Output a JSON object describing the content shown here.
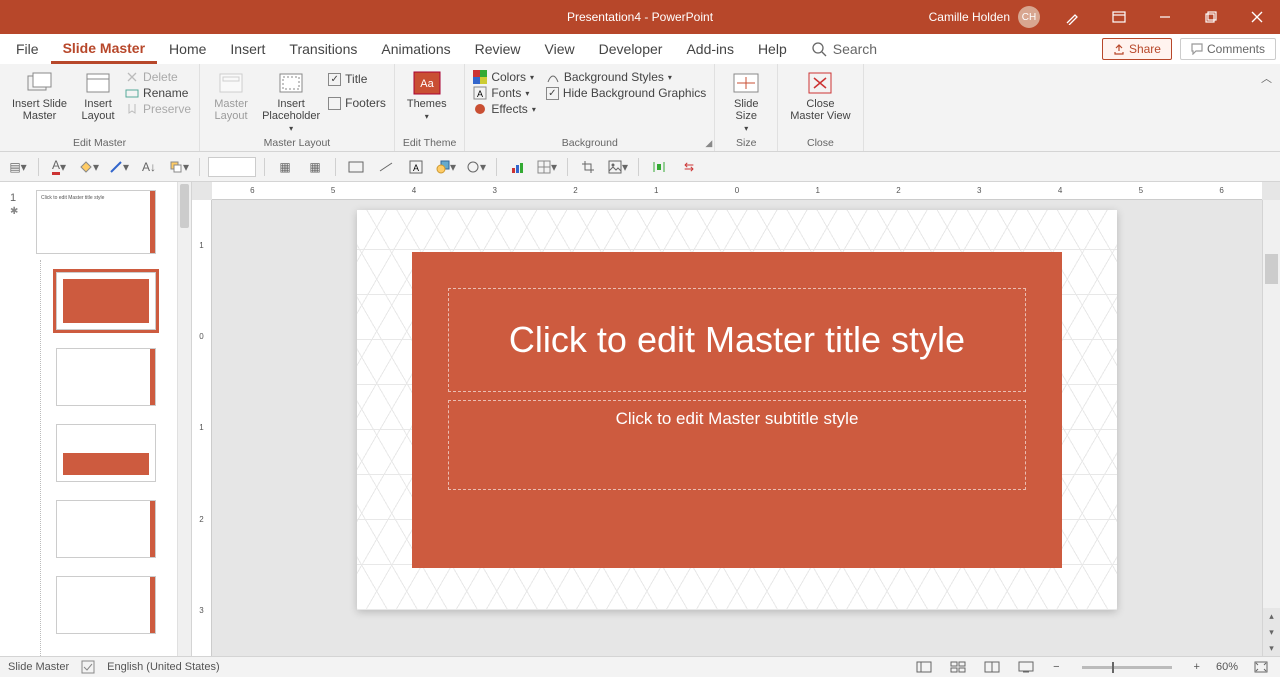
{
  "titlebar": {
    "title": "Presentation4  -  PowerPoint",
    "user": "Camille Holden",
    "avatar": "CH"
  },
  "tabs": {
    "file": "File",
    "slide_master": "Slide Master",
    "home": "Home",
    "insert": "Insert",
    "transitions": "Transitions",
    "animations": "Animations",
    "review": "Review",
    "view": "View",
    "developer": "Developer",
    "addins": "Add-ins",
    "help": "Help",
    "search": "Search",
    "share": "Share",
    "comments": "Comments"
  },
  "ribbon": {
    "edit_master": {
      "insert_slide_master": "Insert Slide\nMaster",
      "insert_layout": "Insert\nLayout",
      "delete": "Delete",
      "rename": "Rename",
      "preserve": "Preserve",
      "label": "Edit Master"
    },
    "master_layout": {
      "master_layout_btn": "Master\nLayout",
      "insert_placeholder": "Insert\nPlaceholder",
      "title": "Title",
      "footers": "Footers",
      "label": "Master Layout"
    },
    "edit_theme": {
      "themes": "Themes",
      "label": "Edit Theme"
    },
    "background": {
      "colors": "Colors",
      "fonts": "Fonts",
      "effects": "Effects",
      "bg_styles": "Background Styles",
      "hide_bg": "Hide Background Graphics",
      "label": "Background"
    },
    "size": {
      "slide_size": "Slide\nSize",
      "label": "Size"
    },
    "close": {
      "close_master": "Close\nMaster View",
      "label": "Close"
    }
  },
  "ruler": {
    "h": [
      "6",
      "5",
      "4",
      "3",
      "2",
      "1",
      "0",
      "1",
      "2",
      "3",
      "4",
      "5",
      "6"
    ],
    "v": [
      "1",
      "0",
      "1",
      "2",
      "3"
    ]
  },
  "slide": {
    "title_ph": "Click to edit Master title style",
    "subtitle_ph": "Click to edit Master subtitle style"
  },
  "panel": {
    "num": "1"
  },
  "status": {
    "view": "Slide Master",
    "lang": "English (United States)",
    "zoom": "60%"
  }
}
